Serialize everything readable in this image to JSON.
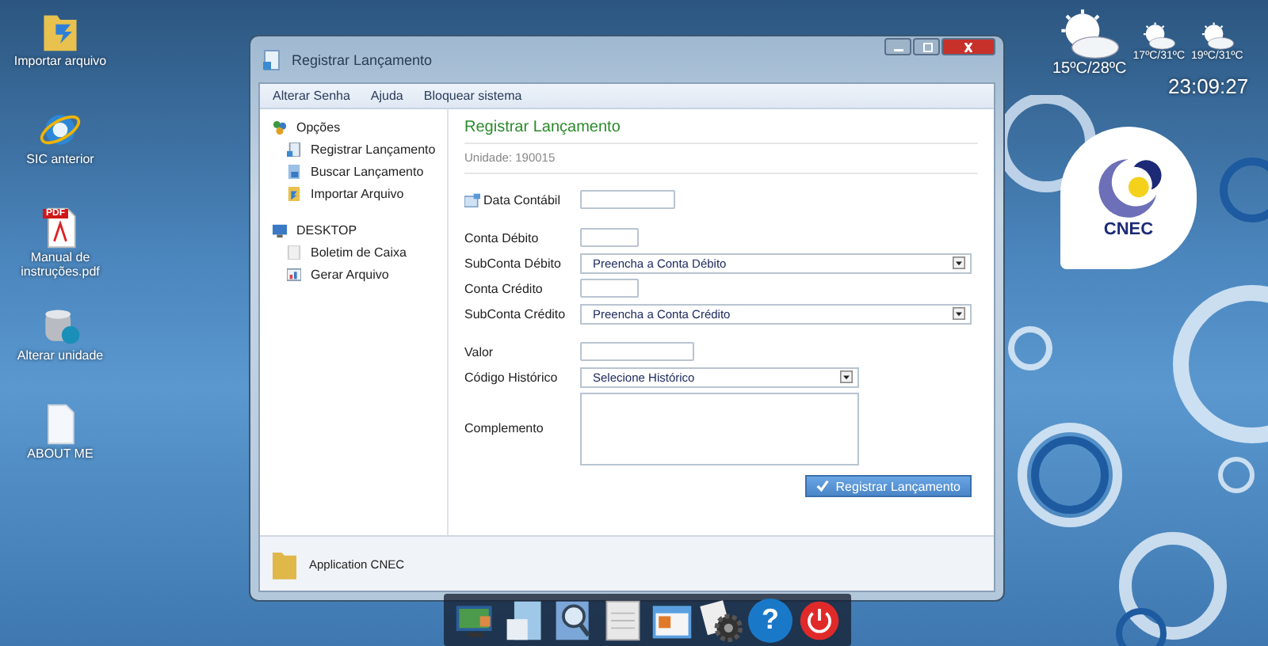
{
  "desktop_icons": [
    {
      "label": "Importar arquivo",
      "kind": "folder"
    },
    {
      "label": "SIC anterior",
      "kind": "browser"
    },
    {
      "label": "Manual de instruções.pdf",
      "kind": "pdf",
      "badge": "PDF"
    },
    {
      "label": "Alterar unidade",
      "kind": "database"
    },
    {
      "label": "ABOUT ME",
      "kind": "document"
    }
  ],
  "window": {
    "title": "Registrar Lançamento",
    "menu": [
      "Alterar Senha",
      "Ajuda",
      "Bloquear sistema"
    ],
    "sidebar": [
      {
        "label": "Opções",
        "kind": "options",
        "items": [
          {
            "label": "Registrar Lançamento",
            "kind": "register"
          },
          {
            "label": "Buscar Lançamento",
            "kind": "search"
          },
          {
            "label": "Importar Arquivo",
            "kind": "import"
          }
        ]
      },
      {
        "label": "DESKTOP",
        "kind": "desktop",
        "items": [
          {
            "label": "Boletim de Caixa",
            "kind": "sheet"
          },
          {
            "label": "Gerar Arquivo",
            "kind": "chart"
          }
        ]
      }
    ],
    "form": {
      "title": "Registrar Lançamento",
      "unit": "Unidade: 190015",
      "groups": [
        [
          {
            "label": "Data Contábil",
            "kind": "text",
            "icon": true
          }
        ],
        [
          {
            "label": "Conta Débito",
            "kind": "text",
            "icon": false
          },
          {
            "label": "SubConta Débito",
            "kind": "select",
            "value": "Preencha a Conta Débito",
            "icon": false
          },
          {
            "label": "Conta Crédito",
            "kind": "text",
            "icon": false
          },
          {
            "label": "SubConta Crédito",
            "kind": "select",
            "value": "Preencha a Conta Crédito",
            "icon": false
          }
        ],
        [
          {
            "label": "Valor",
            "kind": "text",
            "icon": false
          },
          {
            "label": "Código Histórico",
            "kind": "select",
            "value": "Selecione Histórico",
            "icon": false
          },
          {
            "label": "Complemento",
            "kind": "textarea",
            "icon": false
          }
        ]
      ],
      "submit": "Registrar Lançamento"
    },
    "footer": "Application CNEC"
  },
  "weather": [
    {
      "temp": "15ºC/28ºC"
    },
    {
      "temp": "17ºC/31ºC"
    },
    {
      "temp": "19ºC/31ºC"
    }
  ],
  "clock": "23:09:27",
  "logo": "CNEC",
  "dock": [
    {
      "kind": "display"
    },
    {
      "kind": "files"
    },
    {
      "kind": "search"
    },
    {
      "kind": "sheet"
    },
    {
      "kind": "window"
    },
    {
      "kind": "gear"
    },
    {
      "kind": "help",
      "label": "?"
    },
    {
      "kind": "power"
    }
  ]
}
